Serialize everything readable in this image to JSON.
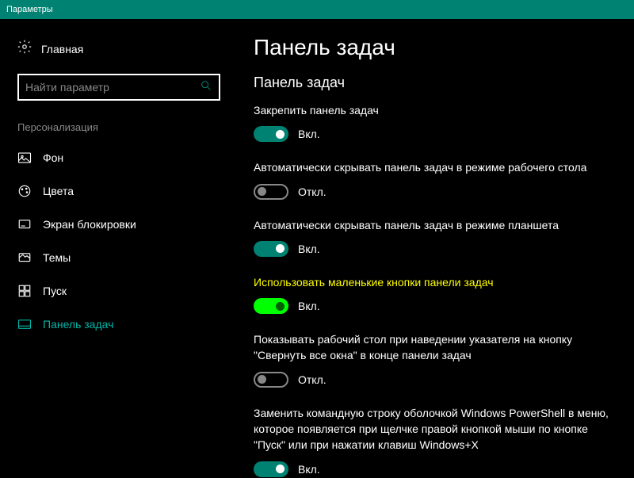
{
  "window_title": "Параметры",
  "sidebar": {
    "home": "Главная",
    "search_placeholder": "Найти параметр",
    "section": "Персонализация",
    "items": [
      {
        "label": "Фон"
      },
      {
        "label": "Цвета"
      },
      {
        "label": "Экран блокировки"
      },
      {
        "label": "Темы"
      },
      {
        "label": "Пуск"
      },
      {
        "label": "Панель задач"
      }
    ]
  },
  "main": {
    "title": "Панель задач",
    "section": "Панель задач",
    "states": {
      "on": "Вкл.",
      "off": "Откл."
    },
    "settings": [
      {
        "label": "Закрепить панель задач",
        "on": true
      },
      {
        "label": "Автоматически скрывать панель задач в режиме рабочего стола",
        "on": false
      },
      {
        "label": "Автоматически скрывать панель задач в режиме планшета",
        "on": true
      },
      {
        "label": "Использовать маленькие кнопки панели задач",
        "on": true,
        "highlight": true
      },
      {
        "label": "Показывать рабочий стол при наведении указателя на кнопку \"Свернуть все окна\" в конце панели задач",
        "on": false
      },
      {
        "label": "Заменить командную строку оболочкой Windows PowerShell в меню, которое появляется при щелчке правой кнопкой мыши по кнопке \"Пуск\" или при нажатии клавиш Windows+X",
        "on": true
      }
    ]
  }
}
